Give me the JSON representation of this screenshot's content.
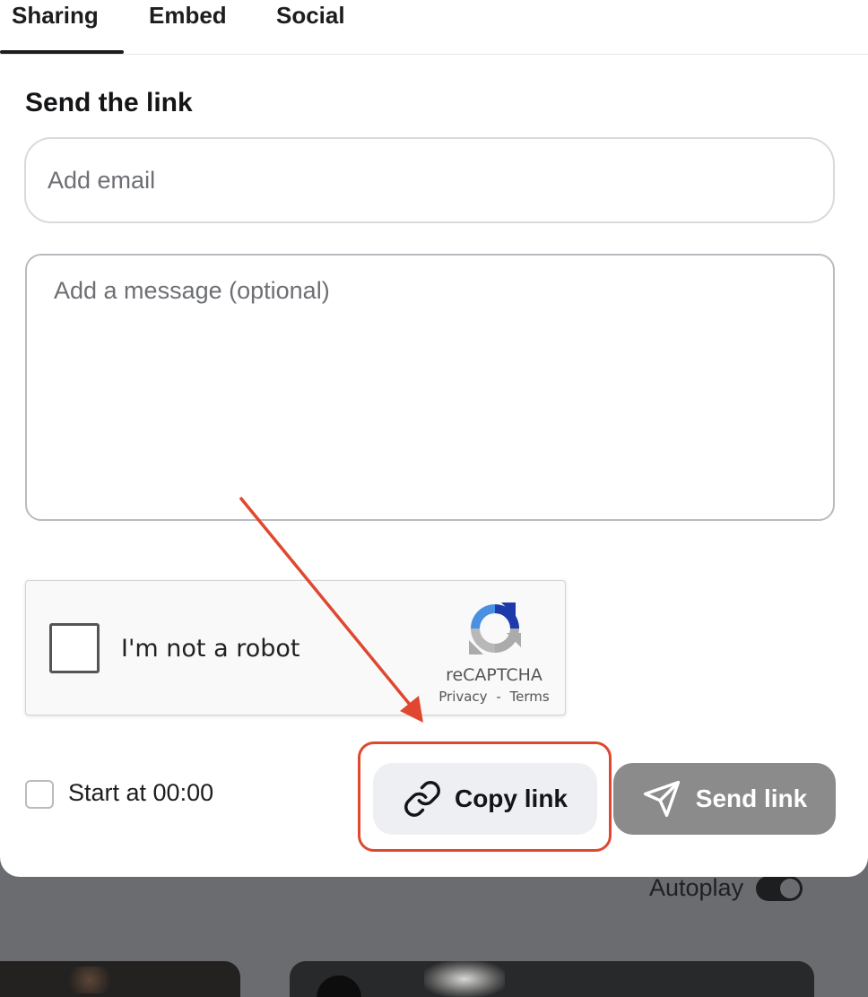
{
  "tabs": [
    {
      "label": "Sharing",
      "active": true
    },
    {
      "label": "Embed",
      "active": false
    },
    {
      "label": "Social",
      "active": false
    }
  ],
  "section_title": "Send the link",
  "email": {
    "placeholder": "Add email",
    "value": ""
  },
  "message": {
    "placeholder": "Add a message (optional)",
    "value": ""
  },
  "recaptcha": {
    "label": "I'm not a robot",
    "brand": "reCAPTCHA",
    "privacy": "Privacy",
    "separator": "-",
    "terms": "Terms",
    "checked": false
  },
  "start_at": {
    "label": "Start at 00:00",
    "checked": false
  },
  "buttons": {
    "copy_link": "Copy link",
    "send_link": "Send link"
  },
  "background": {
    "autoplay_label": "Autoplay",
    "autoplay_on": true
  },
  "colors": {
    "annotation": "#e0472f",
    "send_button_bg": "#8b8b8b",
    "copy_button_bg": "#eeeff2",
    "overlay": "#6b6c6f"
  },
  "icons": {
    "copy_link": "link-icon",
    "send_link": "paper-plane-icon",
    "recaptcha": "recaptcha-logo-icon"
  }
}
